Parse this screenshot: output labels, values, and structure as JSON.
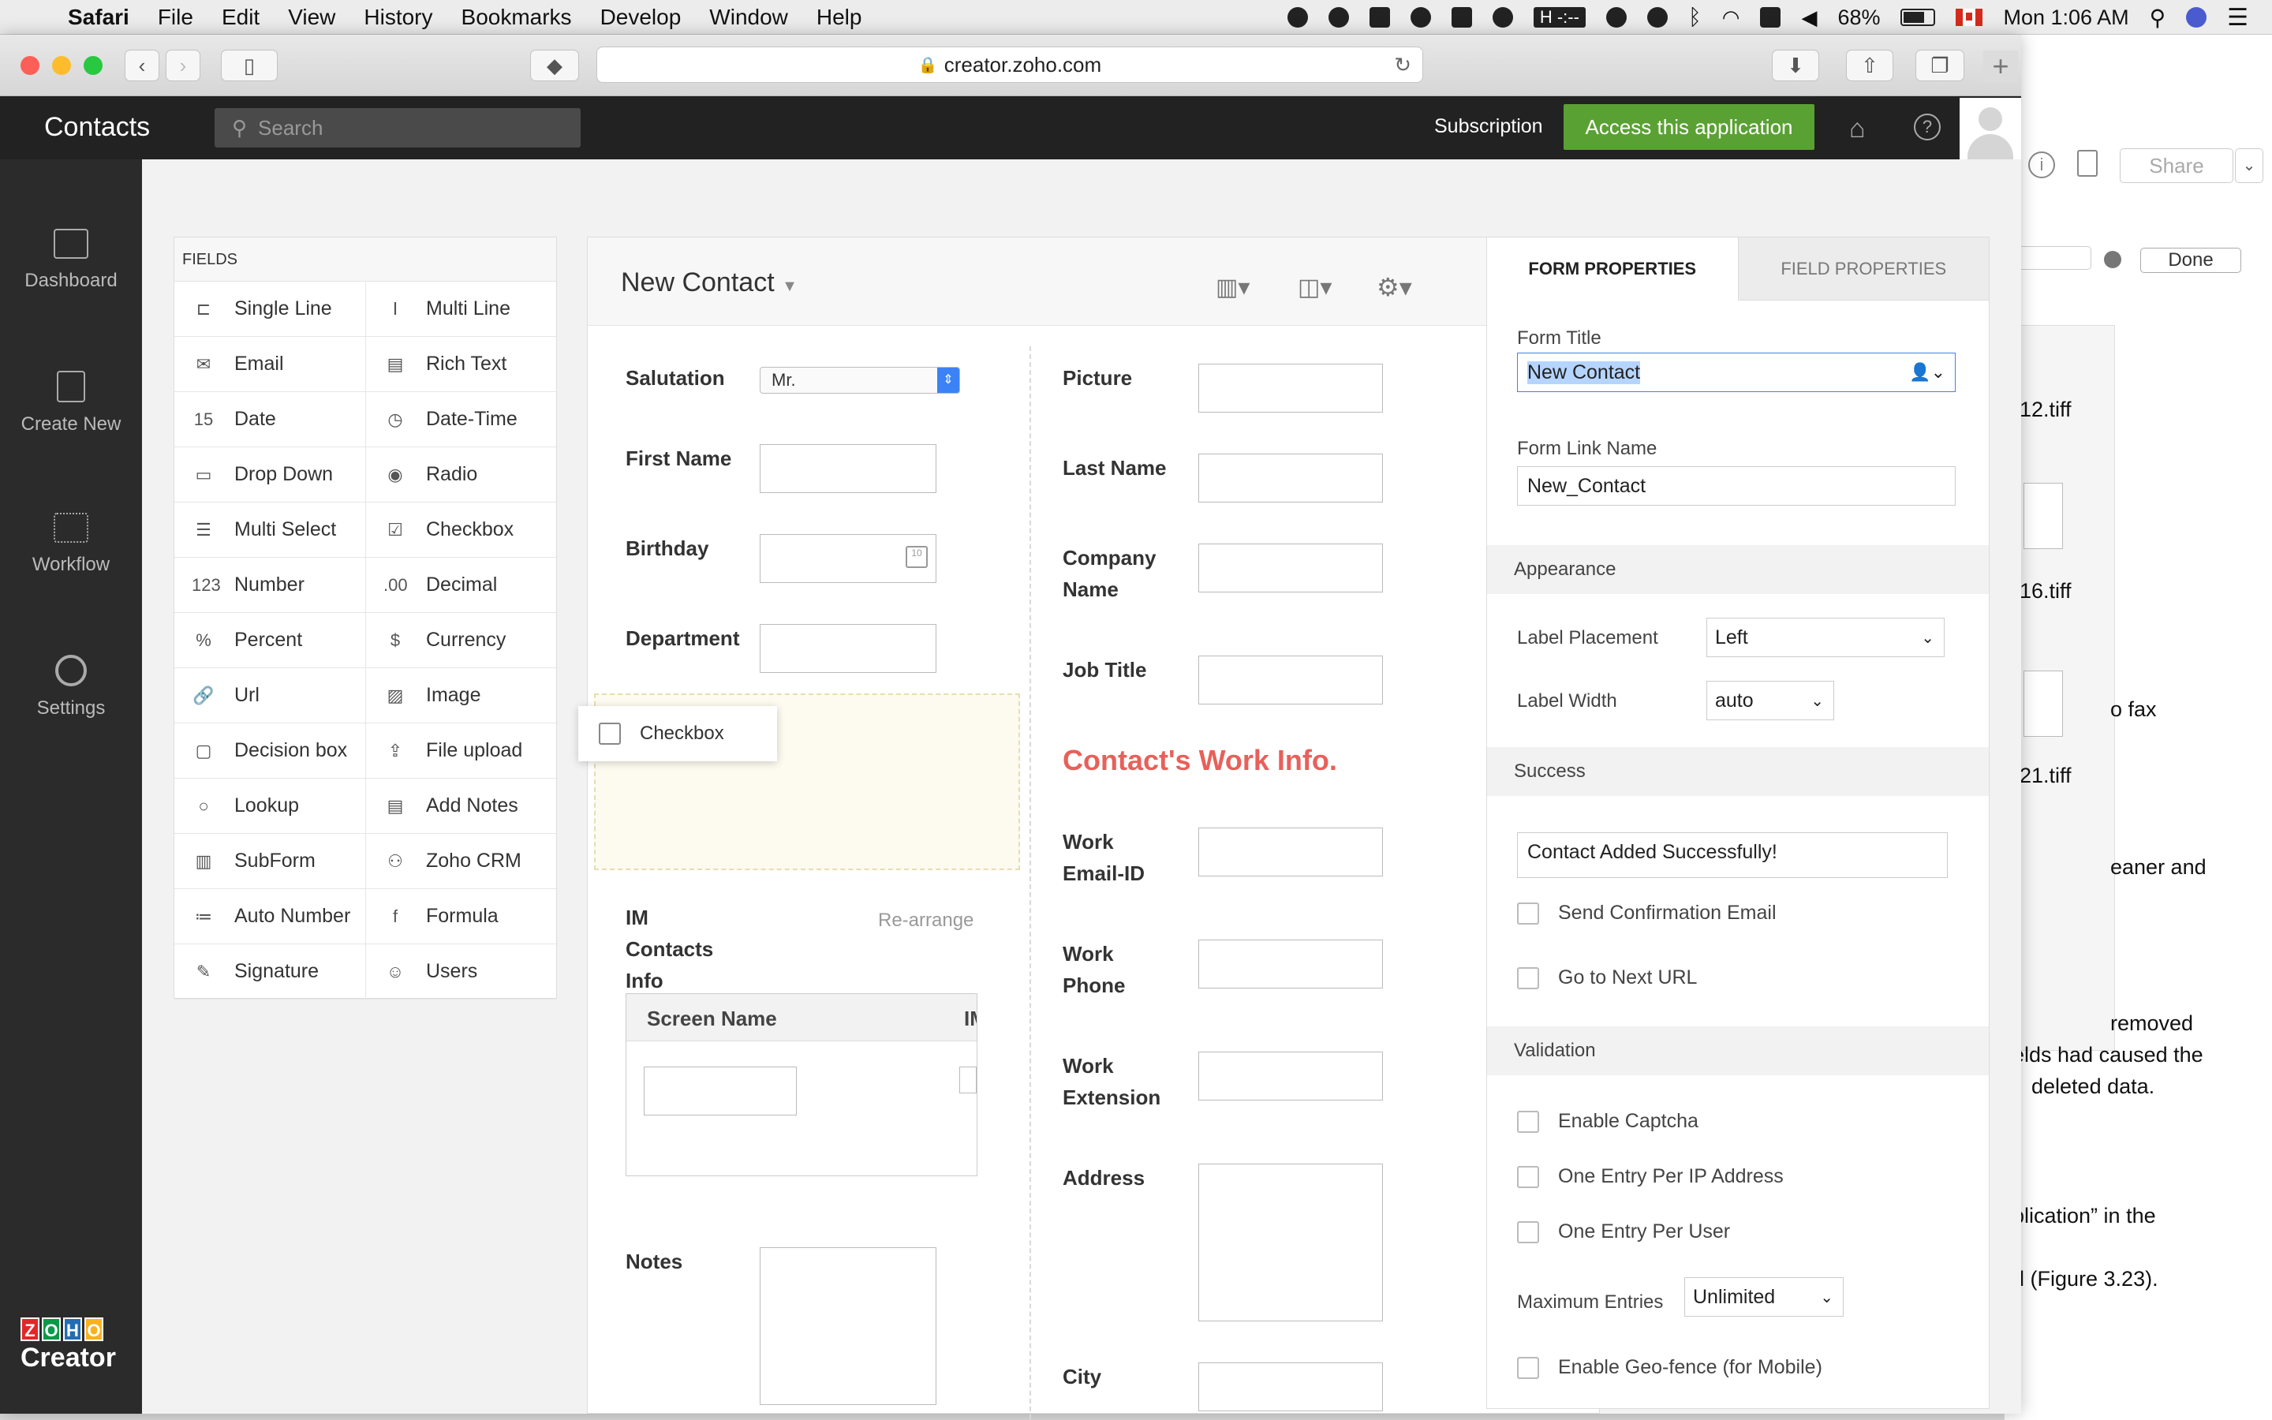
{
  "menubar": {
    "apple": "",
    "app": "Safari",
    "items": [
      "File",
      "Edit",
      "View",
      "History",
      "Bookmarks",
      "Develop",
      "Window",
      "Help"
    ],
    "battery": "68%",
    "clock": "Mon 1:06 AM",
    "timer": "-:--"
  },
  "browser": {
    "url": "creator.zoho.com"
  },
  "header": {
    "app_title": "Contacts",
    "search_placeholder": "Search",
    "subscription": "Subscription",
    "access_button": "Access this application",
    "handle": "≡"
  },
  "nav": {
    "items": [
      {
        "label": "Dashboard",
        "icon": "monitor-icon"
      },
      {
        "label": "Create New",
        "icon": "plus-square-icon"
      },
      {
        "label": "Workflow",
        "icon": "workflow-icon"
      },
      {
        "label": "Settings",
        "icon": "gear-icon"
      }
    ],
    "logo_letters": [
      "Z",
      "O",
      "H",
      "O"
    ],
    "logo_text": "Creator"
  },
  "fields": {
    "header": "FIELDS",
    "items": [
      {
        "label": "Single Line",
        "icon": "⊏"
      },
      {
        "label": "Multi Line",
        "icon": "Ⅰ"
      },
      {
        "label": "Email",
        "icon": "✉"
      },
      {
        "label": "Rich Text",
        "icon": "▤"
      },
      {
        "label": "Date",
        "icon": "15"
      },
      {
        "label": "Date-Time",
        "icon": "◷"
      },
      {
        "label": "Drop Down",
        "icon": "▭"
      },
      {
        "label": "Radio",
        "icon": "◉"
      },
      {
        "label": "Multi Select",
        "icon": "☰"
      },
      {
        "label": "Checkbox",
        "icon": "☑"
      },
      {
        "label": "Number",
        "icon": "123"
      },
      {
        "label": "Decimal",
        "icon": ".00"
      },
      {
        "label": "Percent",
        "icon": "%"
      },
      {
        "label": "Currency",
        "icon": "$"
      },
      {
        "label": "Url",
        "icon": "🔗"
      },
      {
        "label": "Image",
        "icon": "▨"
      },
      {
        "label": "Decision box",
        "icon": "▢"
      },
      {
        "label": "File upload",
        "icon": "⇪"
      },
      {
        "label": "Lookup",
        "icon": "○"
      },
      {
        "label": "Add Notes",
        "icon": "▤"
      },
      {
        "label": "SubForm",
        "icon": "▥"
      },
      {
        "label": "Zoho CRM",
        "icon": "⚇"
      },
      {
        "label": "Auto Number",
        "icon": "≔"
      },
      {
        "label": "Formula",
        "icon": "f"
      },
      {
        "label": "Signature",
        "icon": "✎"
      },
      {
        "label": "Users",
        "icon": "☺"
      }
    ]
  },
  "form": {
    "title": "New Contact",
    "salutation_label": "Salutation",
    "salutation_value": "Mr.",
    "first_name": "First Name",
    "birthday": "Birthday",
    "department": "Department",
    "drag_item": "Checkbox",
    "im_label": "IM Contacts Info",
    "rearrange": "Re-arrange",
    "screen_name": "Screen Name",
    "subform_col2": "IM",
    "notes": "Notes",
    "picture": "Picture",
    "last_name": "Last Name",
    "company_name": "Company Name",
    "job_title": "Job Title",
    "work_section": "Contact's Work Info.",
    "work_email": "Work Email-ID",
    "work_phone": "Work Phone",
    "work_extension": "Work Extension",
    "address": "Address",
    "city": "City"
  },
  "props": {
    "tab_form": "FORM PROPERTIES",
    "tab_field": "FIELD PROPERTIES",
    "form_title_label": "Form Title",
    "form_title_value": "New Contact",
    "link_name_label": "Form Link Name",
    "link_name_value": "New_Contact",
    "appearance": "Appearance",
    "label_placement": "Label Placement",
    "label_placement_value": "Left",
    "label_width": "Label Width",
    "label_width_value": "auto",
    "success": "Success",
    "success_message": "Contact Added Successfully!",
    "send_email": "Send Confirmation Email",
    "next_url": "Go to Next URL",
    "validation": "Validation",
    "captcha": "Enable Captcha",
    "per_ip": "One Entry Per IP Address",
    "per_user": "One Entry Per User",
    "max_entries": "Maximum Entries",
    "max_entries_value": "Unlimited",
    "geofence": "Enable Geo-fence (for Mobile)"
  },
  "background_window": {
    "share": "Share",
    "done": "Done",
    "lines": [
      "-12.tiff",
      "-16.tiff",
      "o fax",
      "-21.tiff",
      "eaner and",
      "removed",
      "elds had caused the",
      "deleted data.",
      "plication” in the",
      "d (Figure 3.23)."
    ]
  },
  "colors": {
    "accent_green": "#5aa133",
    "section_red": "#e8605a",
    "dark_header": "#222222"
  }
}
